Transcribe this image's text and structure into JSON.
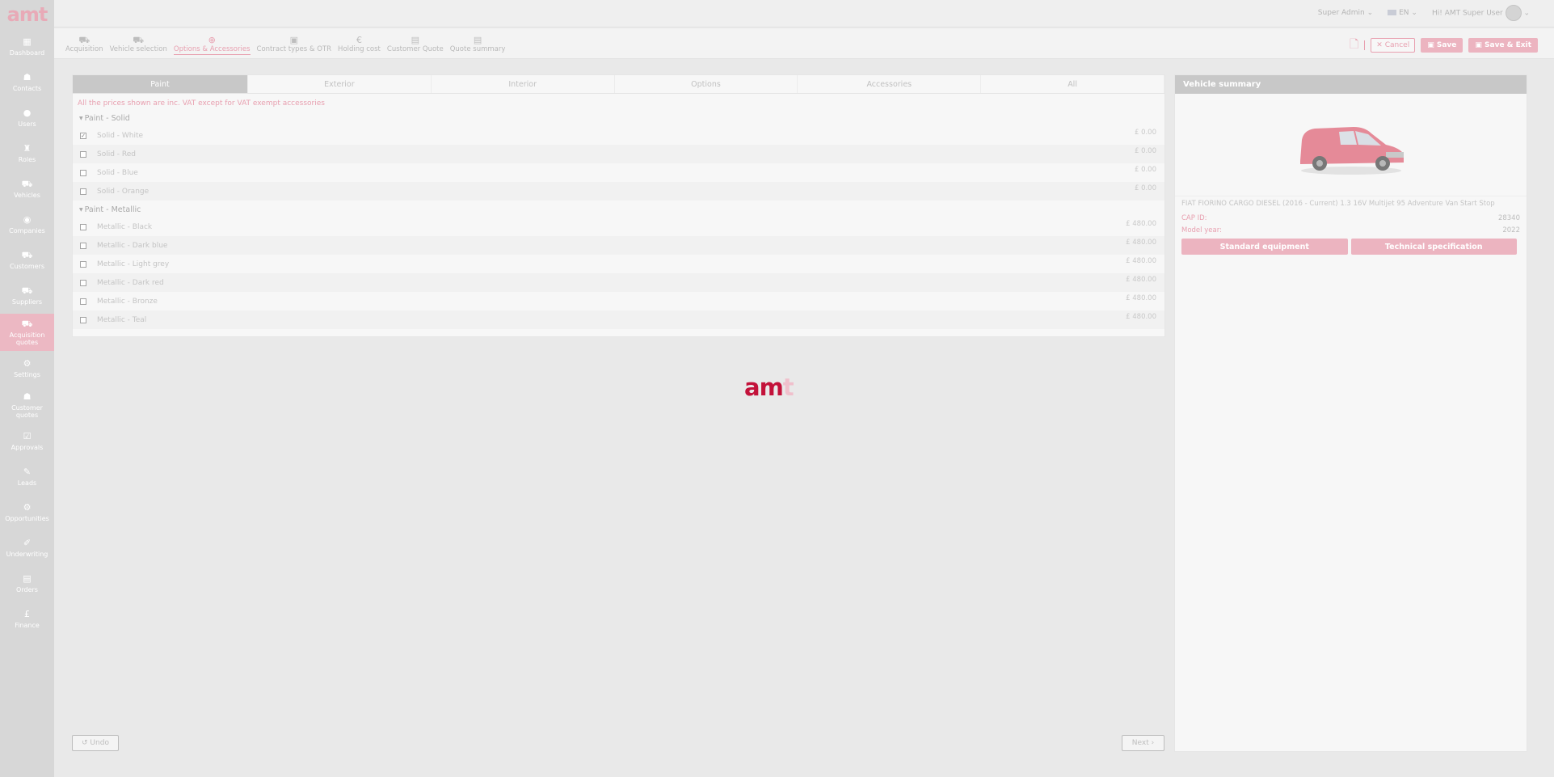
{
  "app": {
    "logo": "amt"
  },
  "sidebar": {
    "items": [
      {
        "label": "Dashboard",
        "icon": "dashboard-icon",
        "glyph": "▦",
        "active": false
      },
      {
        "label": "Contacts",
        "icon": "contacts-icon",
        "glyph": "☗",
        "active": false
      },
      {
        "label": "Users",
        "icon": "users-icon",
        "glyph": "●",
        "active": false
      },
      {
        "label": "Roles",
        "icon": "roles-icon",
        "glyph": "♜",
        "active": false
      },
      {
        "label": "Vehicles",
        "icon": "vehicles-icon",
        "glyph": "⛟",
        "active": false
      },
      {
        "label": "Companies",
        "icon": "companies-icon",
        "glyph": "◉",
        "active": false
      },
      {
        "label": "Customers",
        "icon": "customers-icon",
        "glyph": "⛟",
        "active": false
      },
      {
        "label": "Suppliers",
        "icon": "suppliers-icon",
        "glyph": "⛟",
        "active": false
      },
      {
        "label": "Acquisition quotes",
        "icon": "acquisition-quotes-icon",
        "glyph": "⛟",
        "active": true
      },
      {
        "label": "Settings",
        "icon": "settings-icon",
        "glyph": "⚙",
        "active": false
      },
      {
        "label": "Customer quotes",
        "icon": "customer-quotes-icon",
        "glyph": "☗",
        "active": false
      },
      {
        "label": "Approvals",
        "icon": "approvals-icon",
        "glyph": "☑",
        "active": false
      },
      {
        "label": "Leads",
        "icon": "leads-icon",
        "glyph": "✎",
        "active": false
      },
      {
        "label": "Opportunities",
        "icon": "opportunities-icon",
        "glyph": "⚙",
        "active": false
      },
      {
        "label": "Underwriting",
        "icon": "underwriting-icon",
        "glyph": "✐",
        "active": false
      },
      {
        "label": "Orders",
        "icon": "orders-icon",
        "glyph": "▤",
        "active": false
      },
      {
        "label": "Finance",
        "icon": "finance-icon",
        "glyph": "£",
        "active": false
      }
    ]
  },
  "topbar": {
    "role": "Super Admin",
    "language": "EN",
    "greeting": "Hi! AMT Super User"
  },
  "steps": [
    {
      "label": "Acquisition",
      "icon": "acquisition-icon",
      "glyph": "⛟",
      "active": false
    },
    {
      "label": "Vehicle selection",
      "icon": "vehicle-selection-icon",
      "glyph": "⛟",
      "active": false
    },
    {
      "label": "Options & Accessories",
      "icon": "options-accessories-icon",
      "glyph": "⊕",
      "active": true
    },
    {
      "label": "Contract types & OTR",
      "icon": "contract-types-icon",
      "glyph": "▣",
      "active": false
    },
    {
      "label": "Holding cost",
      "icon": "holding-cost-icon",
      "glyph": "€",
      "active": false
    },
    {
      "label": "Customer Quote",
      "icon": "customer-quote-icon",
      "glyph": "▤",
      "active": false
    },
    {
      "label": "Quote summary",
      "icon": "quote-summary-icon",
      "glyph": "▤",
      "active": false
    }
  ],
  "actions": {
    "cancel": "✕ Cancel",
    "save": "Save",
    "save_exit": "Save & Exit"
  },
  "tabs": [
    "Paint",
    "Exterior",
    "Interior",
    "Options",
    "Accessories",
    "All"
  ],
  "vat_note": "All the prices shown are inc. VAT except for VAT exempt accessories",
  "groups": [
    {
      "title": "Paint - Solid",
      "options": [
        {
          "label": "Solid - White",
          "price": "£ 0.00",
          "checked": true
        },
        {
          "label": "Solid - Red",
          "price": "£ 0.00",
          "checked": false
        },
        {
          "label": "Solid - Blue",
          "price": "£ 0.00",
          "checked": false
        },
        {
          "label": "Solid - Orange",
          "price": "£ 0.00",
          "checked": false
        }
      ]
    },
    {
      "title": "Paint - Metallic",
      "options": [
        {
          "label": "Metallic - Black",
          "price": "£ 480.00",
          "checked": false
        },
        {
          "label": "Metallic - Dark blue",
          "price": "£ 480.00",
          "checked": false
        },
        {
          "label": "Metallic - Light grey",
          "price": "£ 480.00",
          "checked": false
        },
        {
          "label": "Metallic - Dark red",
          "price": "£ 480.00",
          "checked": false
        },
        {
          "label": "Metallic - Bronze",
          "price": "£ 480.00",
          "checked": false
        },
        {
          "label": "Metallic - Teal",
          "price": "£ 480.00",
          "checked": false
        }
      ]
    }
  ],
  "vehicle_summary": {
    "title": "Vehicle summary",
    "description": "FIAT FIORINO CARGO DIESEL (2016 - Current) 1.3 16V Multijet 95 Adventure Van Start Stop",
    "cap_id_label": "CAP ID:",
    "cap_id": "28340",
    "model_year_label": "Model year:",
    "model_year": "2022",
    "standard_equipment": "Standard equipment",
    "technical_specification": "Technical specification"
  },
  "loader": {
    "a": "a",
    "m": "m",
    "t": "t"
  },
  "footer": {
    "undo": "↺ Undo",
    "next": "Next ›"
  },
  "colors": {
    "accent": "#e8a0b0",
    "brand": "#c3123a",
    "sidebar": "#d7d7d7"
  }
}
